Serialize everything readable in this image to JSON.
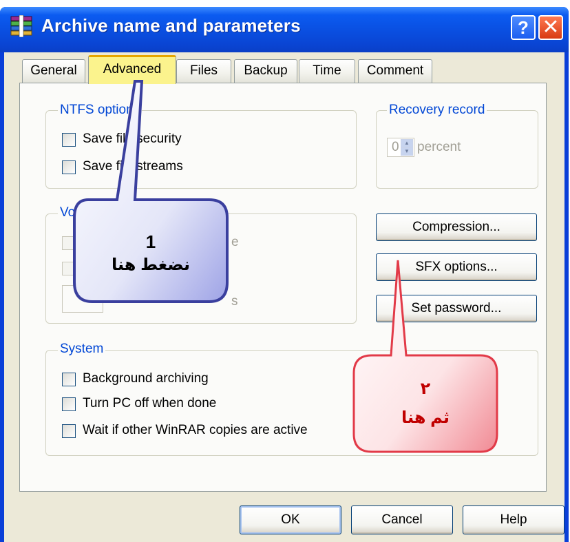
{
  "window": {
    "title": "Archive name and parameters",
    "help_glyph": "?",
    "close_glyph": "✕",
    "app_icon": "winrar-books-icon"
  },
  "tabs": [
    {
      "label": "General"
    },
    {
      "label": "Advanced",
      "selected": true
    },
    {
      "label": "Files"
    },
    {
      "label": "Backup"
    },
    {
      "label": "Time"
    },
    {
      "label": "Comment"
    }
  ],
  "ntfs": {
    "legend": "NTFS options",
    "items": [
      {
        "label": "Save file security",
        "checked": false
      },
      {
        "label": "Save file streams",
        "checked": false
      }
    ]
  },
  "recovery": {
    "legend": "Recovery record",
    "value": "0",
    "unit": "percent"
  },
  "volumes": {
    "legend": "Volumes",
    "item_fragments": [
      "e",
      "s"
    ]
  },
  "buttons": {
    "compression": "Compression...",
    "sfx": "SFX options...",
    "password": "Set password..."
  },
  "system": {
    "legend": "System",
    "items": [
      {
        "label": "Background archiving",
        "checked": false
      },
      {
        "label": "Turn PC off when done",
        "checked": false
      },
      {
        "label": "Wait if other WinRAR copies are active",
        "checked": false
      }
    ]
  },
  "footer": {
    "ok": "OK",
    "cancel": "Cancel",
    "help": "Help"
  },
  "callouts": [
    {
      "number": "1",
      "text": "نضغط هنا",
      "color": "#3a3f9e"
    },
    {
      "number": "٢",
      "text": "ثم هنا",
      "color": "#c00000"
    }
  ]
}
